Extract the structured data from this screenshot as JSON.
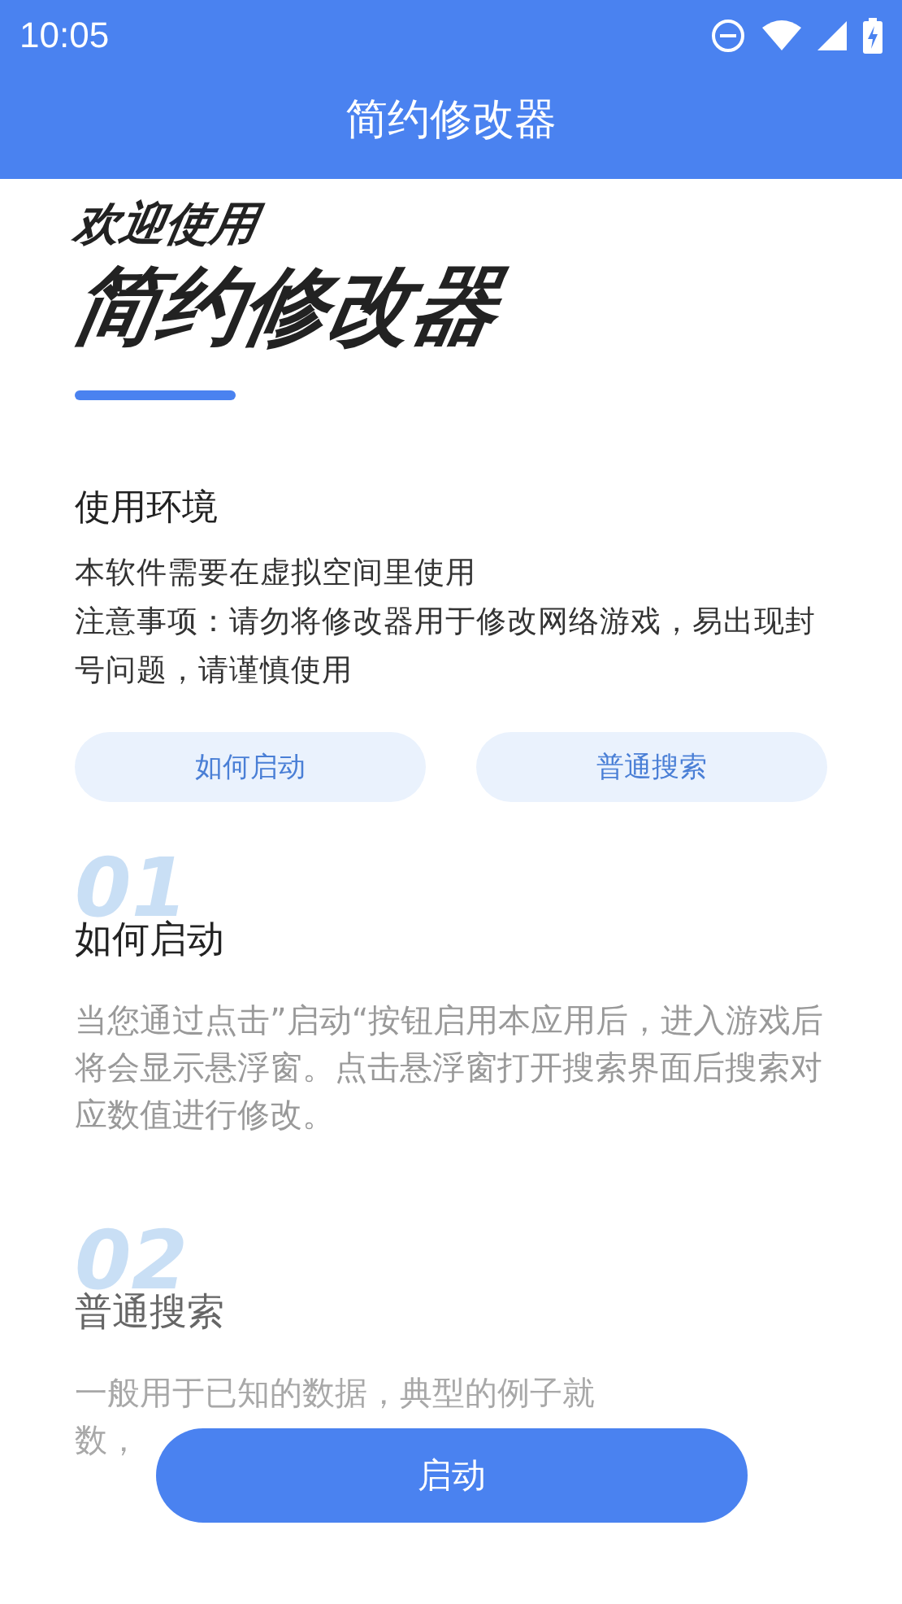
{
  "status_bar": {
    "time": "10:05"
  },
  "app_bar": {
    "title": "简约修改器"
  },
  "hero": {
    "subtitle": "欢迎使用",
    "title": "简约修改器"
  },
  "environment": {
    "heading": "使用环境",
    "lines": [
      "本软件需要在虚拟空间里使用",
      "注意事项：请勿将修改器用于修改网络游戏，易出现封号问题，请谨慎使用"
    ]
  },
  "shortcuts": [
    {
      "label": "如何启动"
    },
    {
      "label": "普通搜索"
    }
  ],
  "sections": [
    {
      "number": "01",
      "title": "如何启动",
      "body": [
        "当您通过点击”启动“按钮启用本应用后，进入游戏后将会显示悬浮窗。点击悬浮窗打开搜索界面后搜索对应数值进行修改。"
      ],
      "faded": false
    },
    {
      "number": "02",
      "title": "普通搜索",
      "body": [
        "一般用于已知的数据，典型的例子就",
        "数，"
      ],
      "faded": true
    }
  ],
  "start_button": {
    "label": "启动"
  }
}
